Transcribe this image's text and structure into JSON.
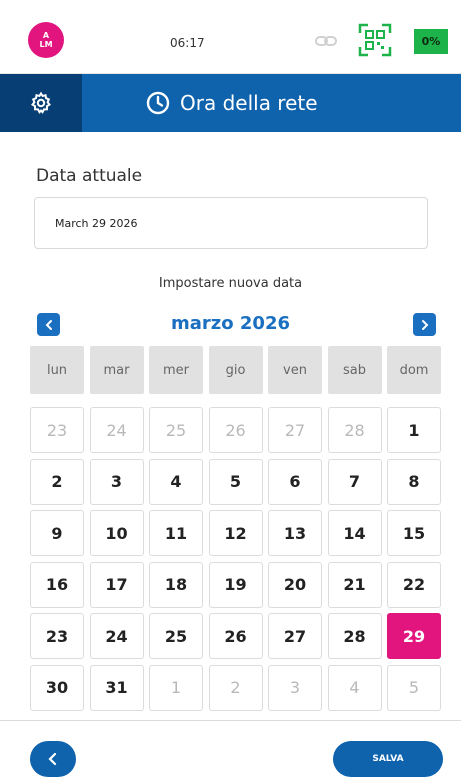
{
  "status_bar": {
    "avatar_line1": "A",
    "avatar_line2": "LM",
    "time": "06:17",
    "battery": "0%"
  },
  "header": {
    "title": "Ora della rete"
  },
  "current_date": {
    "label": "Data attuale",
    "value": "March 29 2026"
  },
  "new_date_label": "Impostare nuova data",
  "calendar": {
    "month_title": "marzo 2026",
    "weekdays": [
      "lun",
      "mar",
      "mer",
      "gio",
      "ven",
      "sab",
      "dom"
    ],
    "weeks": [
      [
        {
          "d": "23",
          "m": true
        },
        {
          "d": "24",
          "m": true
        },
        {
          "d": "25",
          "m": true
        },
        {
          "d": "26",
          "m": true
        },
        {
          "d": "27",
          "m": true
        },
        {
          "d": "28",
          "m": true
        },
        {
          "d": "1",
          "m": false
        }
      ],
      [
        {
          "d": "2",
          "m": false
        },
        {
          "d": "3",
          "m": false
        },
        {
          "d": "4",
          "m": false
        },
        {
          "d": "5",
          "m": false
        },
        {
          "d": "6",
          "m": false
        },
        {
          "d": "7",
          "m": false
        },
        {
          "d": "8",
          "m": false
        }
      ],
      [
        {
          "d": "9",
          "m": false
        },
        {
          "d": "10",
          "m": false
        },
        {
          "d": "11",
          "m": false
        },
        {
          "d": "12",
          "m": false
        },
        {
          "d": "13",
          "m": false
        },
        {
          "d": "14",
          "m": false
        },
        {
          "d": "15",
          "m": false
        }
      ],
      [
        {
          "d": "16",
          "m": false
        },
        {
          "d": "17",
          "m": false
        },
        {
          "d": "18",
          "m": false
        },
        {
          "d": "19",
          "m": false
        },
        {
          "d": "20",
          "m": false
        },
        {
          "d": "21",
          "m": false
        },
        {
          "d": "22",
          "m": false
        }
      ],
      [
        {
          "d": "23",
          "m": false
        },
        {
          "d": "24",
          "m": false
        },
        {
          "d": "25",
          "m": false
        },
        {
          "d": "26",
          "m": false
        },
        {
          "d": "27",
          "m": false
        },
        {
          "d": "28",
          "m": false
        },
        {
          "d": "29",
          "m": false,
          "selected": true
        }
      ],
      [
        {
          "d": "30",
          "m": false
        },
        {
          "d": "31",
          "m": false
        },
        {
          "d": "1",
          "m": true
        },
        {
          "d": "2",
          "m": true
        },
        {
          "d": "3",
          "m": true
        },
        {
          "d": "4",
          "m": true
        },
        {
          "d": "5",
          "m": true
        }
      ]
    ]
  },
  "footer": {
    "save_label": "SALVA"
  },
  "colors": {
    "primary": "#0f62ac",
    "primary_dark": "#073f74",
    "accent": "#e1157d",
    "battery": "#1bb34a",
    "qr": "#1bb34a"
  },
  "icons": {
    "settings": "gear-icon",
    "clock": "clock-icon",
    "qr": "qr-code-icon",
    "link": "link-icon",
    "prev": "chevron-left-icon",
    "next": "chevron-right-icon",
    "back": "chevron-left-icon"
  }
}
